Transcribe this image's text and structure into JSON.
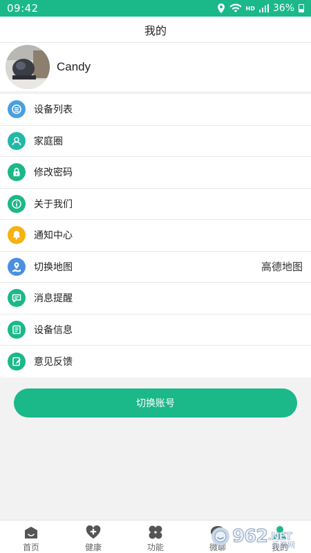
{
  "status_bar": {
    "time": "09:42",
    "network_label": "HD",
    "battery": "36%"
  },
  "header": {
    "title": "我的"
  },
  "profile": {
    "name": "Candy"
  },
  "menu": {
    "items": [
      {
        "label": "设备列表",
        "icon": "device-list-icon",
        "color": "#4a9fe0"
      },
      {
        "label": "家庭圈",
        "icon": "family-icon",
        "color": "#23b8a6"
      },
      {
        "label": "修改密码",
        "icon": "lock-icon",
        "color": "#1bb88a"
      },
      {
        "label": "关于我们",
        "icon": "info-icon",
        "color": "#1bb88a"
      },
      {
        "label": "通知中心",
        "icon": "bell-icon",
        "color": "#f5b312"
      },
      {
        "label": "切换地图",
        "icon": "map-icon",
        "color": "#4a8fe0",
        "value": "高德地图"
      },
      {
        "label": "消息提醒",
        "icon": "message-icon",
        "color": "#1bb88a"
      },
      {
        "label": "设备信息",
        "icon": "device-info-icon",
        "color": "#1bb88a"
      },
      {
        "label": "意见反馈",
        "icon": "feedback-icon",
        "color": "#1bb88a"
      }
    ]
  },
  "switch_account": {
    "label": "切换账号"
  },
  "tabs": [
    {
      "label": "首页",
      "icon": "home-icon"
    },
    {
      "label": "健康",
      "icon": "health-icon"
    },
    {
      "label": "功能",
      "icon": "functions-icon"
    },
    {
      "label": "微聊",
      "icon": "chat-icon"
    },
    {
      "label": "我的",
      "icon": "profile-icon"
    }
  ],
  "watermark": {
    "text": "962",
    "suffix": ".NET",
    "sub": "乐游网"
  },
  "colors": {
    "accent": "#1bb88a"
  }
}
